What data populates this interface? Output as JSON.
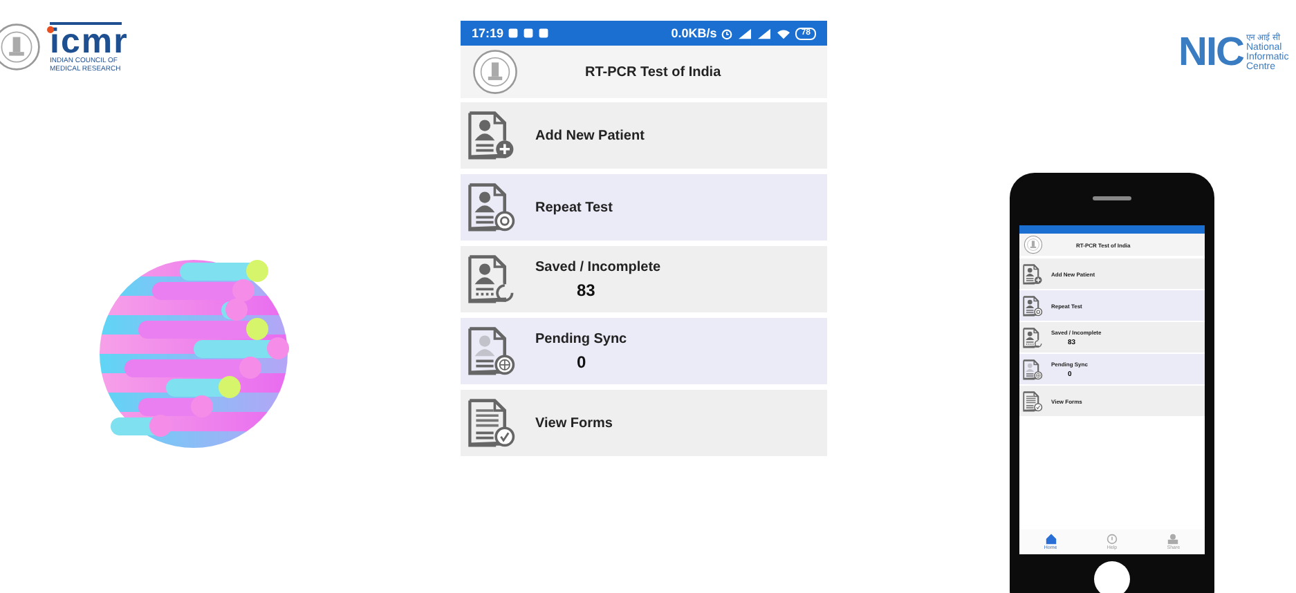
{
  "left_logo": {
    "acronym": "icmr",
    "name_lines": [
      "INDIAN COUNCIL OF",
      "MEDICAL RESEARCH"
    ]
  },
  "right_logo": {
    "acronym": "NIC",
    "hindi": "एन आई सी",
    "name_lines": [
      "National",
      "Informatic",
      "Centre"
    ]
  },
  "app_screen": {
    "status_bar": {
      "time": "17:19",
      "speed": "0.0KB/s",
      "battery": "78"
    },
    "title": "RT-PCR Test of India",
    "menu": [
      {
        "kind": "add",
        "label": "Add New Patient"
      },
      {
        "kind": "repeat",
        "label": "Repeat Test"
      },
      {
        "kind": "saved",
        "label": "Saved / Incomplete",
        "count": "83"
      },
      {
        "kind": "pending",
        "label": "Pending Sync",
        "count": "0"
      },
      {
        "kind": "view",
        "label": "View Forms"
      }
    ]
  },
  "phone_mockup": {
    "title": "RT-PCR Test of India",
    "menu": [
      {
        "kind": "add",
        "label": "Add New Patient"
      },
      {
        "kind": "repeat",
        "label": "Repeat Test"
      },
      {
        "kind": "saved",
        "label": "Saved / Incomplete",
        "count": "83"
      },
      {
        "kind": "pending",
        "label": "Pending Sync",
        "count": "0"
      },
      {
        "kind": "view",
        "label": "View Forms"
      }
    ],
    "nav": [
      {
        "kind": "home",
        "label": "Home",
        "selected": true
      },
      {
        "kind": "help",
        "label": "Help",
        "selected": false
      },
      {
        "kind": "share",
        "label": "Share",
        "selected": false
      }
    ]
  }
}
